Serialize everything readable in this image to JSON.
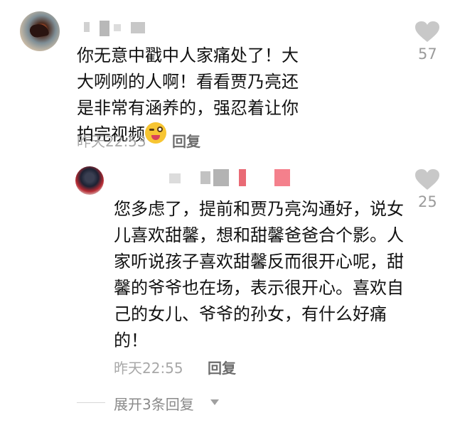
{
  "comments": [
    {
      "text": "你无意中戳中人家痛处了！大大咧咧的人啊！看看贾乃亮还是非常有涵养的，强忍着让你拍完视频",
      "emoji_icon": "wink-tongue-emoji",
      "time": "昨天22:53",
      "reply_label": "回复",
      "likes": "57"
    },
    {
      "text": "您多虑了，提前和贾乃亮沟通好，说女儿喜欢甜馨，想和甜馨爸爸合个影。人家听说孩子喜欢甜馨反而很开心呢，甜馨的爷爷也在场，表示很开心。喜欢自己的女儿、爷爷的孙女，有什么好痛的！",
      "time": "昨天22:55",
      "reply_label": "回复",
      "likes": "25"
    }
  ],
  "expand_replies": "展开3条回复",
  "colors": {
    "meta_gray": "#a8a8a8",
    "heart_gray": "#c8c8c8"
  }
}
